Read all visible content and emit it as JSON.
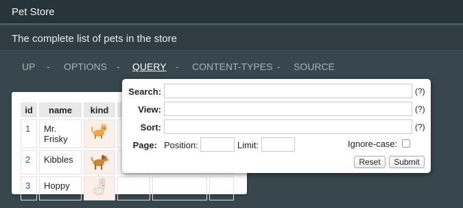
{
  "app": {
    "title": "Pet Store"
  },
  "subtitle": "The complete list of pets in the store",
  "nav": {
    "items": [
      {
        "label": "UP",
        "active": false
      },
      {
        "label": "OPTIONS",
        "active": false
      },
      {
        "label": "QUERY",
        "active": true
      },
      {
        "label": "CONTENT-TYPES",
        "active": false
      },
      {
        "label": "SOURCE",
        "active": false
      }
    ],
    "separator": "-"
  },
  "table": {
    "headers": [
      "id",
      "name",
      "kind"
    ],
    "rows": [
      {
        "id": "1",
        "name": "Mr. Frisky",
        "kind_icon": "cat-icon"
      },
      {
        "id": "2",
        "name": "Kibbles",
        "kind_icon": "dog-icon"
      },
      {
        "id": "3",
        "name": "Hoppy",
        "kind_icon": "rabbit-icon"
      }
    ]
  },
  "query": {
    "search_label": "Search:",
    "search_value": "",
    "view_label": "View:",
    "view_value": "",
    "sort_label": "Sort:",
    "sort_value": "",
    "help": "(?)",
    "page_label": "Page:",
    "position_label": "Position:",
    "position_value": "",
    "limit_label": "Limit:",
    "limit_value": "",
    "ignore_case_label": "Ignore-case:",
    "ignore_case_checked": false,
    "reset_label": "Reset",
    "submit_label": "Submit"
  },
  "colors": {
    "background": "#38474d",
    "topbar": "#27343a",
    "subtitle_bar": "#2f3d43",
    "nav_text": "#a4b3b6",
    "id_link": "#2d5f88",
    "kind_cell": "#fbefe8"
  }
}
